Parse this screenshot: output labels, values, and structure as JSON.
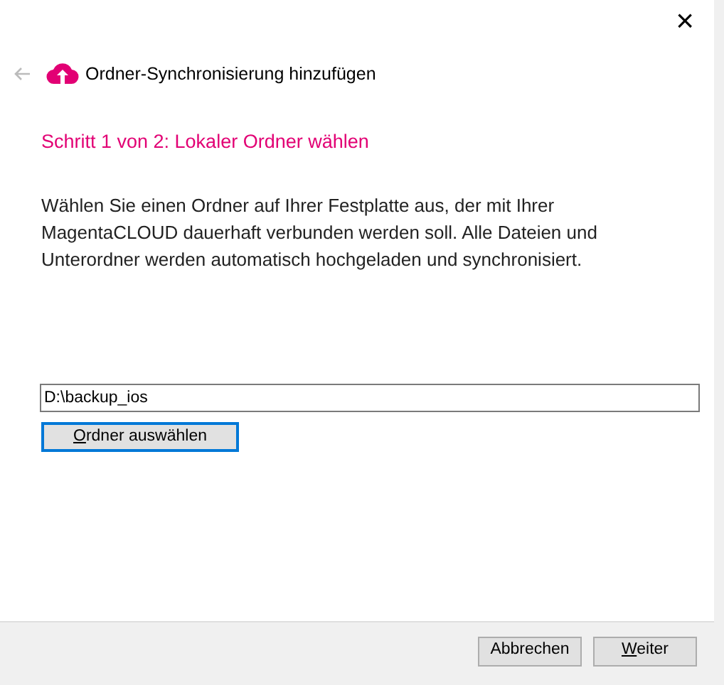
{
  "window": {
    "close": "×"
  },
  "header": {
    "title": "Ordner-Synchronisierung hinzufügen",
    "back_enabled": false
  },
  "step_title": "Schritt 1 von 2: Lokaler Ordner wählen",
  "description": "Wählen Sie einen Ordner auf Ihrer Festplatte aus, der mit Ihrer MagentaCLOUD dauerhaft verbunden werden soll. Alle Dateien und Unterordner werden automatisch hochgeladen und synchronisiert.",
  "folder_field": {
    "value": "D:\\backup_ios"
  },
  "choose_button": {
    "access_key": "O",
    "rest": "rdner auswählen",
    "focused": true
  },
  "buttons": [
    {
      "rest": "Abbrechen"
    },
    {
      "access_key": "W",
      "rest": "eiter"
    }
  ]
}
